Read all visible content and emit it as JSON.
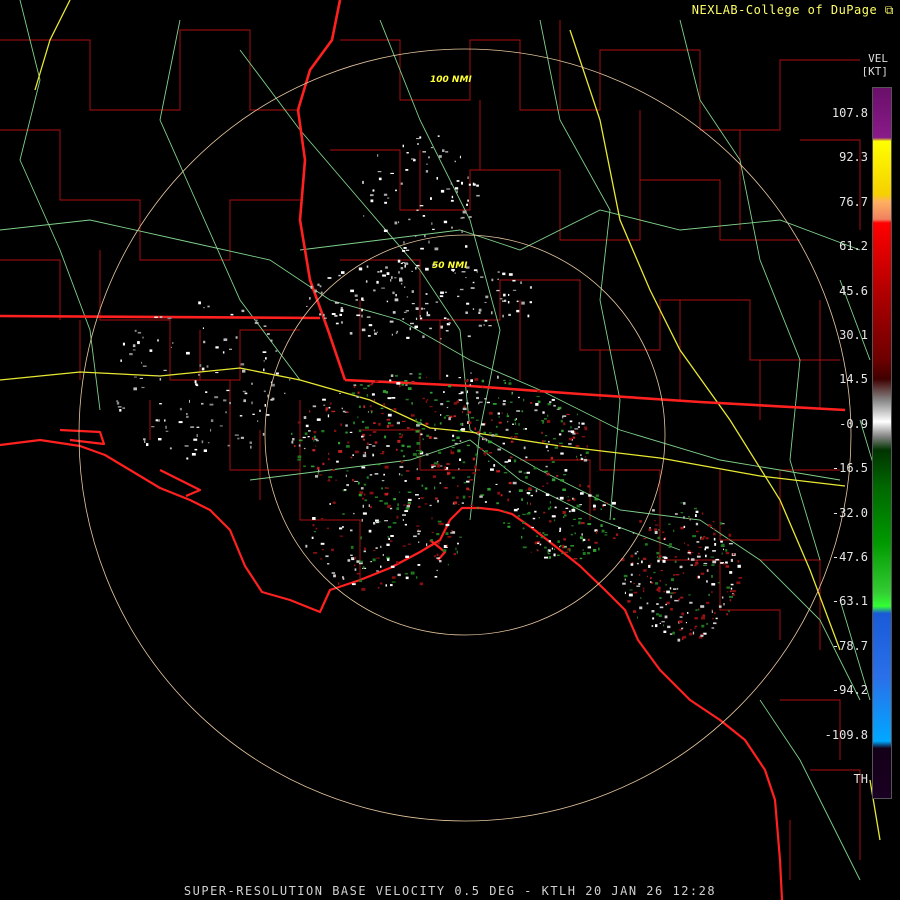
{
  "credit": "NEXLAB-College of DuPage",
  "legend": {
    "title": "VEL",
    "units": "[KT]",
    "labels": [
      "107.8",
      "92.3",
      "76.7",
      "61.2",
      "45.6",
      "30.1",
      "14.5",
      "-0.9",
      "-16.5",
      "-32.0",
      "-47.6",
      "-63.1",
      "-78.7",
      "-94.2",
      "-109.8",
      "TH"
    ]
  },
  "range_rings": [
    "100 NMI",
    "50 NMI"
  ],
  "footer": "SUPER-RESOLUTION BASE VELOCITY 0.5 DEG - KTLH 20 JAN 26 12:28",
  "colors": {
    "background": "#000000",
    "county_lines": "#b01010",
    "state_lines": "#ff2020",
    "roads": "#7fd18a",
    "interstates": "#e8e832",
    "range_rings": "#e8c8a0"
  }
}
